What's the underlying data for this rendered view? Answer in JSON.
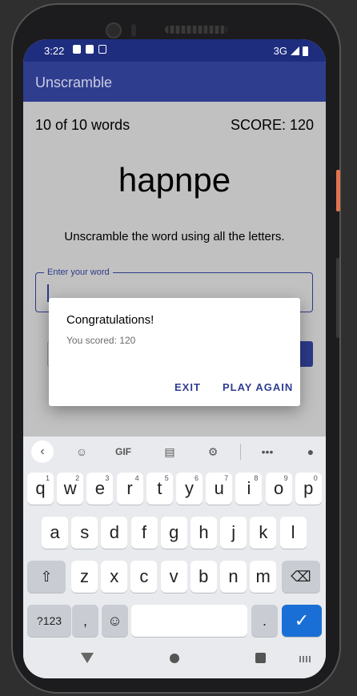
{
  "status_bar": {
    "time": "3:22",
    "network": "3G"
  },
  "app": {
    "title": "Unscramble"
  },
  "game": {
    "word_count": "10 of 10 words",
    "score": "SCORE: 120",
    "scrambled_word": "hapnpe",
    "instructions": "Unscramble the word using all the letters.",
    "input_label": "Enter your word"
  },
  "dialog": {
    "title": "Congratulations!",
    "message": "You scored: 120",
    "exit_label": "EXIT",
    "play_again_label": "PLAY AGAIN"
  },
  "keyboard": {
    "toolbar": {
      "gif_label": "GIF"
    },
    "row1": [
      {
        "k": "q",
        "n": "1"
      },
      {
        "k": "w",
        "n": "2"
      },
      {
        "k": "e",
        "n": "3"
      },
      {
        "k": "r",
        "n": "4"
      },
      {
        "k": "t",
        "n": "5"
      },
      {
        "k": "y",
        "n": "6"
      },
      {
        "k": "u",
        "n": "7"
      },
      {
        "k": "i",
        "n": "8"
      },
      {
        "k": "o",
        "n": "9"
      },
      {
        "k": "p",
        "n": "0"
      }
    ],
    "row2": [
      "a",
      "s",
      "d",
      "f",
      "g",
      "h",
      "j",
      "k",
      "l"
    ],
    "row3": [
      "z",
      "x",
      "c",
      "v",
      "b",
      "n",
      "m"
    ],
    "symbols_label": "?123",
    "comma": ",",
    "period": "."
  },
  "colors": {
    "app_bar": "#2f3d8f",
    "status_bar": "#1e2d7e",
    "enter_key": "#1a6fd6"
  }
}
